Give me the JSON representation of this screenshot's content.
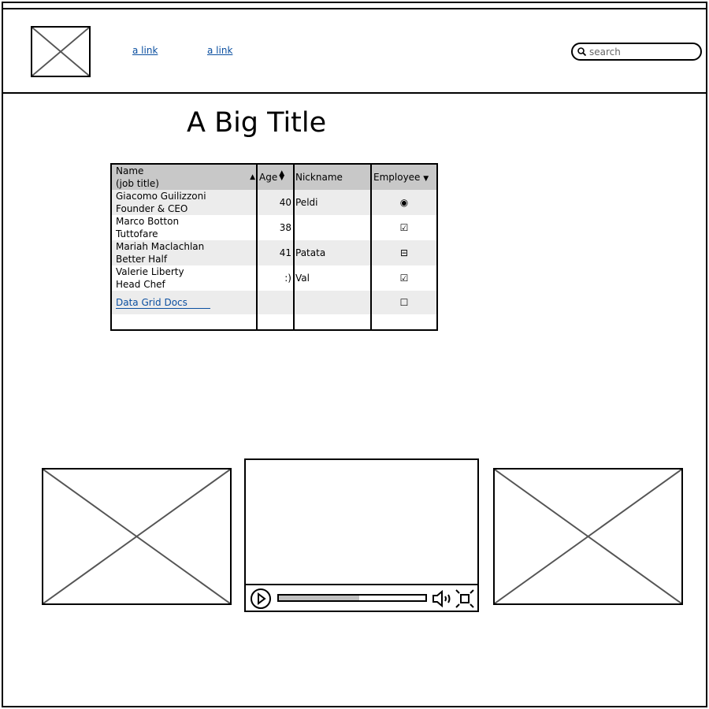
{
  "nav": {
    "links": [
      "a link",
      "a link"
    ],
    "search_placeholder": "search"
  },
  "title": "A Big Title",
  "grid": {
    "headers": {
      "name": "Name",
      "name_sub": "(job title)",
      "age": "Age",
      "nickname": "Nickname",
      "employee": "Employee"
    },
    "rows": [
      {
        "name": "Giacomo Guilizzoni",
        "title": "Founder & CEO",
        "age": "40",
        "nickname": "Peldi",
        "employee": "radio-selected"
      },
      {
        "name": "Marco Botton",
        "title": "Tuttofare",
        "age": "38",
        "nickname": "",
        "employee": "checked"
      },
      {
        "name": "Mariah Maclachlan",
        "title": "Better Half",
        "age": "41",
        "nickname": "Patata",
        "employee": "indeterminate"
      },
      {
        "name": "Valerie Liberty",
        "title": "Head Chef",
        "age": ":)",
        "nickname": "Val",
        "employee": "checked"
      }
    ],
    "footer_link": "Data Grid Docs",
    "footer_employee": "unchecked"
  },
  "video": {
    "progress": 0.55
  },
  "colors": {
    "link": "#0b4fa0",
    "header_bg": "#c8c8c8",
    "stripe": "#ececec"
  }
}
